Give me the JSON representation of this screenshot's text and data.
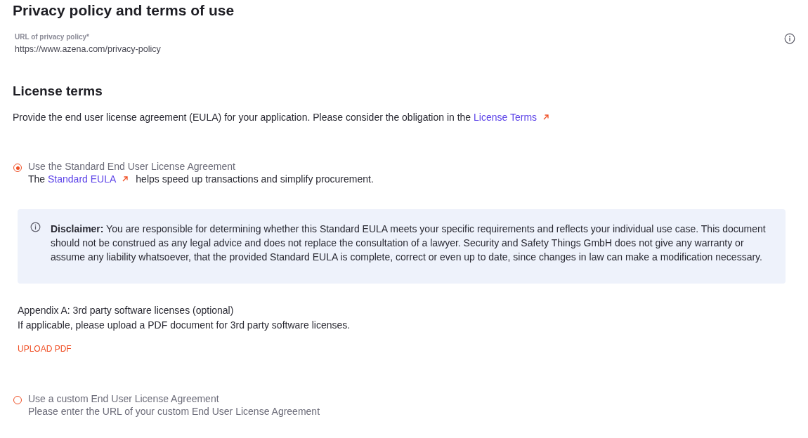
{
  "privacy": {
    "title": "Privacy policy and terms of use",
    "field": {
      "label": "URL of privacy policy*",
      "value": "https://www.azena.com/privacy-policy"
    }
  },
  "license": {
    "title": "License terms",
    "intro": {
      "before": "Provide the end user license agreement (EULA) for your application. Please consider the obligation in the ",
      "link": "License Terms"
    },
    "options": [
      {
        "kind": "standard",
        "selected": true,
        "label": "Use the Standard End User License Agreement",
        "description": {
          "before": "The ",
          "link": "Standard EULA",
          "after": "helps speed up transactions and simplify procurement."
        },
        "disclaimer": "**Disclaimer:** You are responsible for determining whether this Standard EULA meets your specific requirements and reflects your individual use case. This document should not be construed as any legal advice and does not replace the consultation of a lawyer. Security and Safety Things GmbH does not give any warranty or assume any liability whatsoever, that the provided Standard EULA is complete, correct or even up to date, since changes in law can make a modification necessary.",
        "appendix": {
          "title": "Appendix A: 3rd party software licenses (optional)",
          "hint": "If applicable, please upload a PDF document for 3rd party software licenses.",
          "button": "UPLOAD PDF"
        }
      },
      {
        "kind": "custom",
        "selected": false,
        "label": "Use a custom End User License Agreement",
        "description": "Please enter the URL of your custom End User License Agreement"
      }
    ]
  }
}
